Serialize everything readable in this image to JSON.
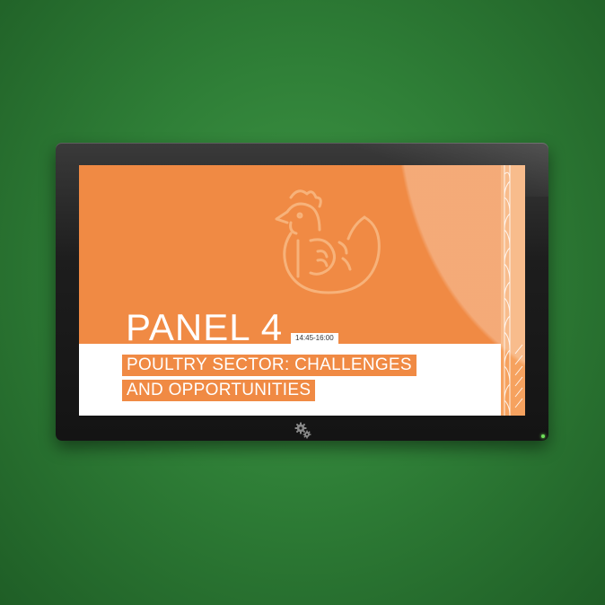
{
  "slide": {
    "title": "PANEL 4",
    "time": "14:45-16:00",
    "subtitle_line1": "POULTRY SECTOR: CHALLENGES",
    "subtitle_line2": "AND OPPORTUNITIES"
  },
  "icons": {
    "watermark": "hen-icon",
    "monitor_logo": "gear-icon",
    "power_indicator": "power-led-icon"
  },
  "colors": {
    "background": "#2f7f37",
    "accent": "#f08a44",
    "bezel": "#1d1d1d",
    "band": "#ffffff"
  }
}
